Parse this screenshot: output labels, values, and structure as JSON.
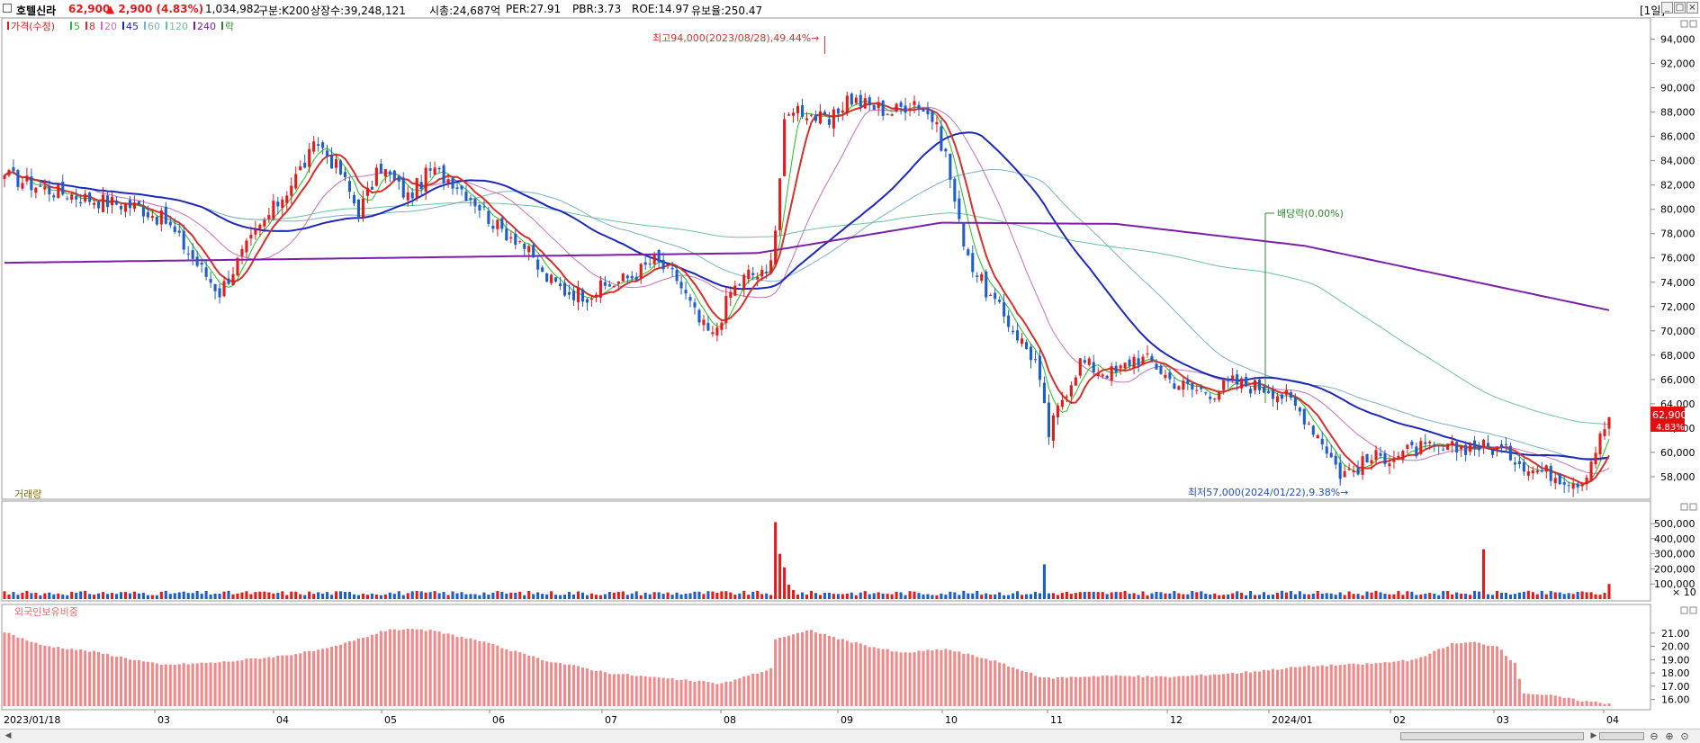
{
  "header": {
    "name": "호텔신라",
    "price": "62,900",
    "change": "▲ 2,900 (4.83%)",
    "volume": "1,034,982",
    "market": "구분:K200",
    "shares": "상장수:39,248,121",
    "mcap": "시총:24,687억",
    "per": "PER:27.91",
    "pbr": "PBR:3.73",
    "roe": "ROE:14.97",
    "float": "유보율:250.47",
    "period": "[1일]",
    "btn_min": "_",
    "btn_max": "□",
    "btn_close": "×"
  },
  "colors": {
    "up": "#e21b1b",
    "down": "#1f5ec8",
    "ma5": "#22c022",
    "ma8": "#d4322a",
    "ma20": "#c66fbf",
    "ma45": "#1c28b8",
    "ma60": "#7ab0c8",
    "ma120": "#6cc39a",
    "ma240": "#7b1fa6",
    "foreign": "#f08a8a",
    "exdiv": "#2a8a2a"
  },
  "price_legend": [
    {
      "label": "가격(수정)",
      "color": "#e21b1b"
    },
    {
      "label": "5",
      "color": "#22c022"
    },
    {
      "label": "8",
      "color": "#d4322a"
    },
    {
      "label": "20",
      "color": "#c66fbf"
    },
    {
      "label": "45",
      "color": "#1c28b8"
    },
    {
      "label": "60",
      "color": "#7ab0c8"
    },
    {
      "label": "120",
      "color": "#6cc39a"
    },
    {
      "label": "240",
      "color": "#7b1fa6"
    },
    {
      "label": "락",
      "color": "#2a8a2a"
    }
  ],
  "volume_label": "거래량",
  "foreign_label": "외국인보유비중",
  "annotations": {
    "high": "최고94,000(2023/08/28),49.44%→",
    "low": "최저57,000(2024/01/22),9.38%→",
    "exdiv": "배당락(0.00%)"
  },
  "current_tag": {
    "price": "62,900",
    "pct": "4.83%"
  },
  "chart_data": {
    "type": "candlestick",
    "x_labels": [
      "2023/01/18",
      "03",
      "04",
      "05",
      "06",
      "07",
      "08",
      "09",
      "10",
      "11",
      "12",
      "2024/01",
      "02",
      "03",
      "04"
    ],
    "price_axis": {
      "ticks": [
        "58,000",
        "60,000",
        "62,000",
        "64,000",
        "66,000",
        "68,000",
        "70,000",
        "72,000",
        "74,000",
        "76,000",
        "78,000",
        "80,000",
        "82,000",
        "84,000",
        "86,000",
        "88,000",
        "90,000",
        "92,000",
        "94,000"
      ],
      "ylim": [
        56000,
        95000
      ]
    },
    "volume_axis": {
      "ticks": [
        "100,000",
        "200,000",
        "300,000",
        "400,000",
        "500,000"
      ],
      "ylim": [
        0,
        560000
      ],
      "unit": "× 10"
    },
    "foreign_axis": {
      "ticks": [
        "16.00",
        "17.00",
        "18.00",
        "19.00",
        "20.00",
        "21.00"
      ],
      "ylim": [
        15.5,
        21.8
      ]
    },
    "anchors": [
      [
        0,
        82800
      ],
      [
        10,
        81600
      ],
      [
        20,
        80800
      ],
      [
        30,
        80200
      ],
      [
        36,
        79000
      ],
      [
        43,
        75500
      ],
      [
        48,
        73200
      ],
      [
        53,
        76300
      ],
      [
        58,
        79000
      ],
      [
        63,
        81600
      ],
      [
        70,
        85500
      ],
      [
        75,
        83000
      ],
      [
        79,
        79800
      ],
      [
        84,
        83500
      ],
      [
        90,
        81000
      ],
      [
        95,
        83200
      ],
      [
        100,
        82400
      ],
      [
        105,
        80700
      ],
      [
        110,
        78500
      ],
      [
        115,
        77500
      ],
      [
        120,
        74600
      ],
      [
        125,
        73300
      ],
      [
        130,
        73000
      ],
      [
        135,
        73800
      ],
      [
        140,
        74500
      ],
      [
        145,
        75800
      ],
      [
        150,
        74300
      ],
      [
        155,
        70700
      ],
      [
        158,
        69500
      ],
      [
        162,
        73200
      ],
      [
        166,
        74700
      ],
      [
        170,
        74500
      ],
      [
        172,
        78500
      ],
      [
        174,
        86800
      ],
      [
        176,
        88500
      ],
      [
        180,
        87800
      ],
      [
        184,
        87000
      ],
      [
        188,
        89200
      ],
      [
        193,
        88500
      ],
      [
        198,
        88000
      ],
      [
        203,
        89000
      ],
      [
        207,
        87500
      ],
      [
        210,
        84500
      ],
      [
        213,
        78700
      ],
      [
        216,
        75300
      ],
      [
        220,
        72700
      ],
      [
        225,
        70200
      ],
      [
        230,
        67500
      ],
      [
        233,
        61500
      ],
      [
        236,
        64500
      ],
      [
        240,
        67500
      ],
      [
        244,
        66800
      ],
      [
        248,
        66500
      ],
      [
        252,
        67800
      ],
      [
        256,
        67500
      ],
      [
        260,
        66000
      ],
      [
        265,
        65200
      ],
      [
        270,
        65000
      ],
      [
        274,
        65800
      ],
      [
        278,
        65500
      ],
      [
        282,
        65300
      ],
      [
        286,
        64500
      ],
      [
        290,
        63000
      ],
      [
        294,
        61000
      ],
      [
        298,
        58300
      ],
      [
        301,
        58600
      ],
      [
        305,
        59500
      ],
      [
        310,
        59800
      ],
      [
        316,
        60300
      ],
      [
        322,
        60200
      ],
      [
        328,
        60600
      ],
      [
        333,
        60300
      ],
      [
        337,
        59600
      ],
      [
        341,
        58600
      ],
      [
        345,
        58300
      ],
      [
        349,
        57800
      ],
      [
        352,
        57700
      ],
      [
        355,
        60300
      ],
      [
        358,
        62900
      ]
    ],
    "high": {
      "value": 94000,
      "date": "2023/08/28",
      "pct": 49.44
    },
    "low": {
      "value": 57000,
      "date": "2024/01/22",
      "pct": 9.38
    },
    "last": {
      "close": 62900,
      "change": 2900,
      "pct": 4.83,
      "volume": 1034982
    },
    "ma240_endpoints": [
      [
        0,
        75600
      ],
      [
        168,
        76400
      ],
      [
        209,
        78900
      ],
      [
        248,
        78800
      ],
      [
        290,
        77000
      ],
      [
        358,
        71700
      ]
    ]
  }
}
